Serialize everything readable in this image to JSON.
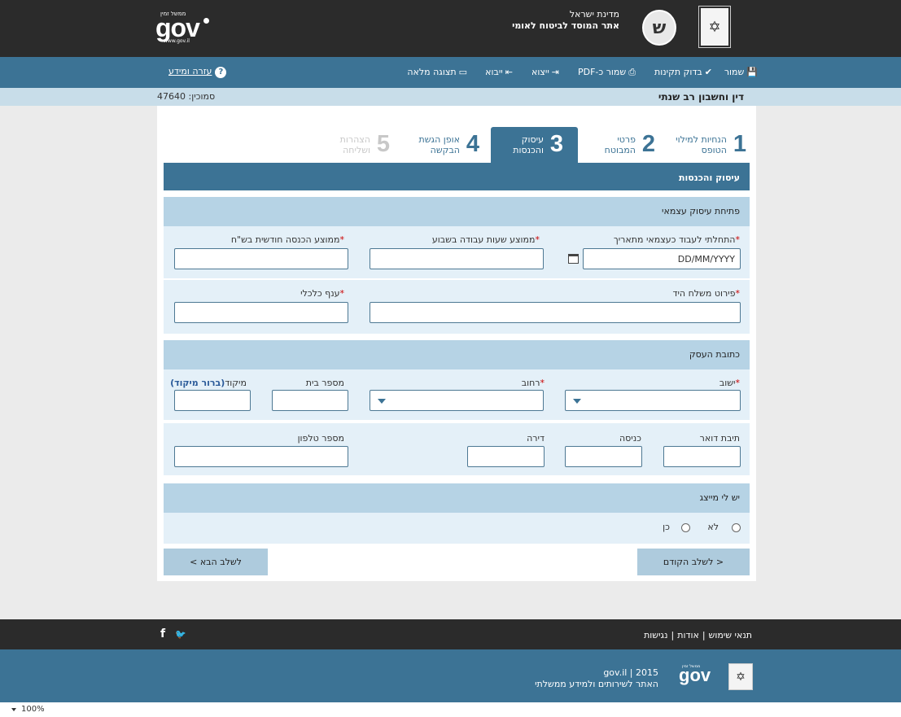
{
  "header": {
    "gov_small": "ממשל זמין",
    "gov_big": "gov",
    "gov_sub": "www.gov.il",
    "state": "מדינת ישראל",
    "site": "אתר המוסד לביטוח לאומי",
    "nii_logo_glyph": "ש",
    "emblem_glyph": "✡"
  },
  "toolbar": {
    "save": "שמור",
    "check": "בדוק תקינות",
    "save_pdf": "שמור כ-PDF",
    "export": "ייצוא",
    "import": "ייבוא",
    "full_view": "תצוגה מלאה",
    "help": "עזרה ומידע",
    "icons": {
      "save": "💾",
      "check": "✔",
      "pdf": "⎙",
      "export": "⇥",
      "import": "⇤",
      "view": "▭"
    }
  },
  "titlebar": {
    "title": "דין וחשבון רב שנתי",
    "ref": "סמוכין: 47640"
  },
  "steps": [
    {
      "num": "1",
      "label_l1": "הנחיות למילוי",
      "label_l2": "הטופס"
    },
    {
      "num": "2",
      "label_l1": "פרטי",
      "label_l2": "המבוטח"
    },
    {
      "num": "3",
      "label_l1": "עיסוק",
      "label_l2": "והכנסות"
    },
    {
      "num": "4",
      "label_l1": "אופן הגשת",
      "label_l2": "הבקשה"
    },
    {
      "num": "5",
      "label_l1": "הצהרות",
      "label_l2": "ושליחה"
    }
  ],
  "section_title": "עיסוק והכנסות",
  "self_employed": {
    "title": "פתיחת עיסוק עצמאי",
    "start_date_label": "התחלתי לעבוד כעצמאי מתאריך",
    "start_date_value": "DD/MM/YYYY",
    "avg_hours_label": "ממוצע שעות עבודה בשבוע",
    "avg_income_label": "ממוצע הכנסה חודשית בש\"ח",
    "occupation_label": "פירוט משלח היד",
    "branch_label": "ענף כלכלי",
    "required_mark": "*"
  },
  "address": {
    "title": "כתובת העסק",
    "city_label": "ישוב",
    "street_label": "רחוב",
    "house_label": "מספר בית",
    "zip_label": "מיקוד",
    "zip_link": "(ברור מיקוד)",
    "pobox_label": "תיבת דואר",
    "entrance_label": "כניסה",
    "apartment_label": "דירה",
    "phone_label": "מספר טלפון"
  },
  "representative": {
    "title": "יש לי מייצג",
    "opt_yes": "כן",
    "opt_no": "לא"
  },
  "nav": {
    "prev": "< לשלב הקודם",
    "next": "לשלב הבא >"
  },
  "footer": {
    "terms": "תנאי שימוש",
    "about": "אודות",
    "access": "נגישות",
    "sep": "|",
    "facebook": "f",
    "twitter": "🐦",
    "copy_l1": "gov.il | 2015",
    "copy_l2": "האתר לשירותים ולמידע ממשלתי",
    "gov_small": "ממשל זמין",
    "gov_big": "gov",
    "emblem_glyph": "✡"
  },
  "statusbar": {
    "zoom": "100%"
  }
}
